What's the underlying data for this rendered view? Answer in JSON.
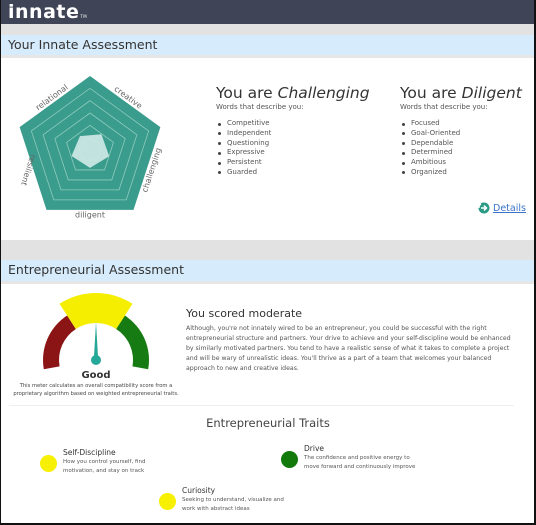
{
  "header": {
    "logo_text": "innate",
    "logo_mark": "TM"
  },
  "section_innate": {
    "title": "Your Innate Assessment",
    "radar": {
      "axes": [
        "creative",
        "challenging",
        "diligent",
        "resilient",
        "relational"
      ],
      "values": [
        0.25,
        0.26,
        0.23,
        0.25,
        0.22
      ],
      "rings": 6,
      "fill_color": "#3a9c8c",
      "data_color": "#cde8e5"
    },
    "primary": {
      "prefix": "You are",
      "trait": "Challenging",
      "subtitle": "Words that describe you:",
      "words": [
        "Competitive",
        "Independent",
        "Questioning",
        "Expressive",
        "Persistent",
        "Guarded"
      ]
    },
    "secondary": {
      "prefix": "You are",
      "trait": "Diligent",
      "subtitle": "Words that describe you:",
      "words": [
        "Focused",
        "Goal-Oriented",
        "Dependable",
        "Determined",
        "Ambitious",
        "Organized"
      ]
    },
    "details_link": "Details"
  },
  "section_entrepreneurial": {
    "title": "Entrepreneurial Assessment",
    "gauge": {
      "rating": "Good",
      "value_fraction": 0.5,
      "colors": {
        "low": "#8b1414",
        "mid": "#f5ee00",
        "high": "#167b12",
        "needle": "#25a898"
      },
      "note": "This meter calculates an overall compatibility score from a proprietary algorithm based on weighted entrepreneurial traits."
    },
    "score_title": "You scored moderate",
    "score_text": "Although, you're not innately wired to be an entrepreneur, you could be successful with the right entrepreneurial structure and partners. Your drive to achieve and your self-discipline would be enhanced by similarly motivated partners. You tend to have a realistic sense of what it takes to complete a project and will be wary of unrealistic ideas. You'll thrive as a part of a team that welcomes your balanced approach to new and creative ideas."
  },
  "traits": {
    "title": "Entrepreneurial Traits",
    "items": [
      {
        "name": "Self-Discipline",
        "description": "How you control yourself, find motivation, and stay on track",
        "color": "#f7f000"
      },
      {
        "name": "Drive",
        "description": "The confidence and positive energy to move forward and continuously improve",
        "color": "#117a0b"
      },
      {
        "name": "Curiosity",
        "description": "Seeking to understand, visualize and work with abstract ideas",
        "color": "#f7f000"
      }
    ]
  }
}
